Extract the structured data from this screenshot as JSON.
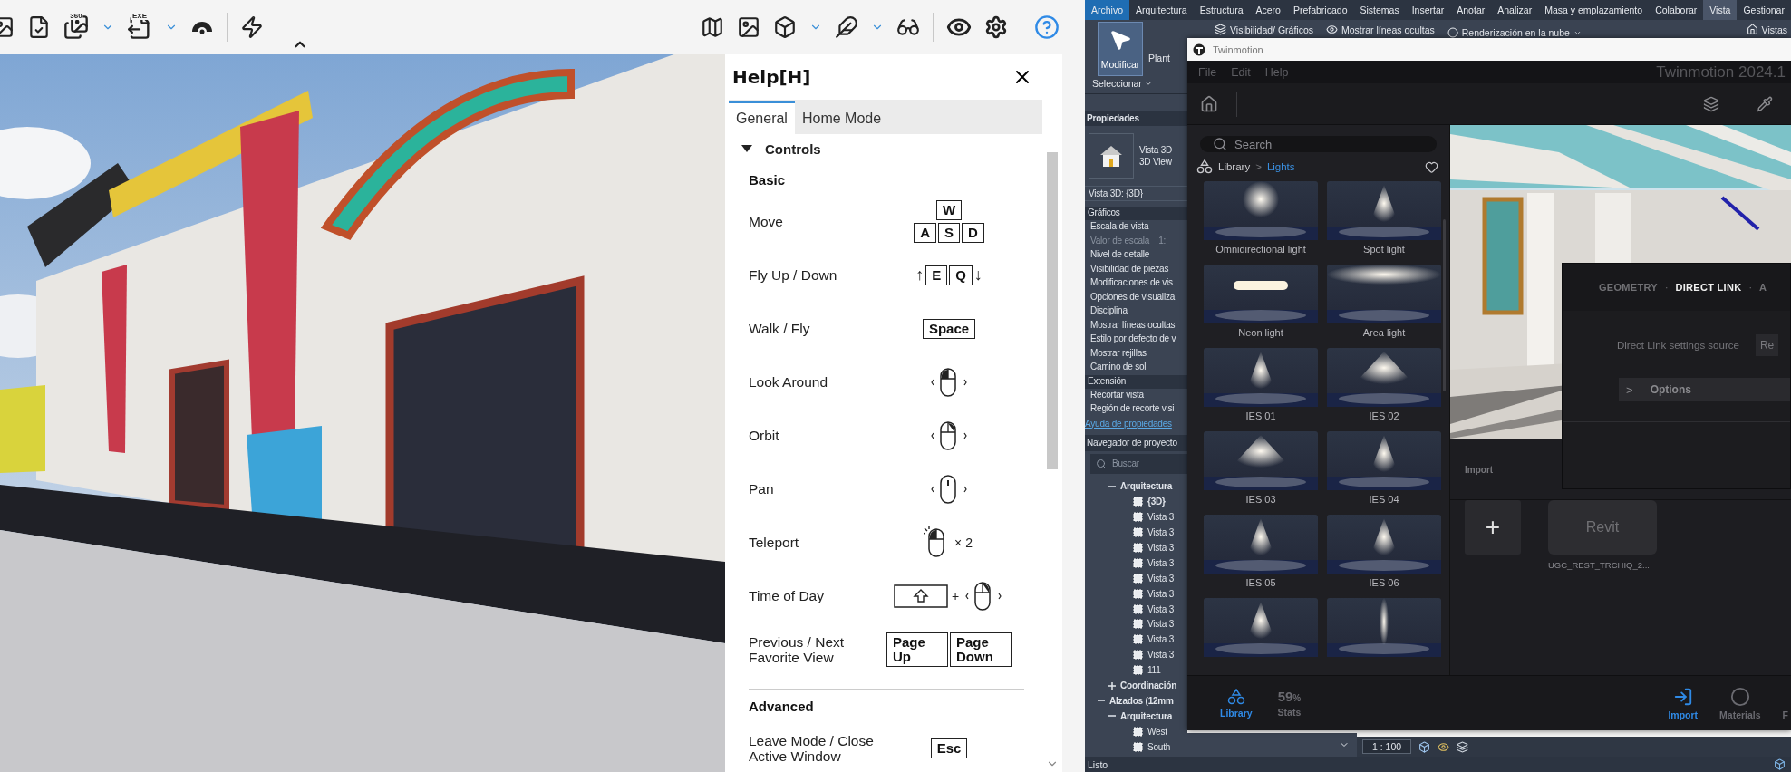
{
  "viewer": {
    "toolbar": {
      "panorama_badge": "360",
      "export_badge": "EXE"
    },
    "help": {
      "title": "Help[H]",
      "tabs": [
        {
          "label": "General",
          "selected": true
        },
        {
          "label": "Home Mode",
          "selected": false
        }
      ],
      "section": {
        "label": "Controls",
        "expanded": true,
        "groups": [
          {
            "title": "Basic",
            "rows": [
              {
                "label": "Move",
                "kind": "keypad",
                "keys": [
                  [
                    "W"
                  ],
                  [
                    "A",
                    "S",
                    "D"
                  ]
                ]
              },
              {
                "label": "Fly Up / Down",
                "kind": "inline",
                "controls": [
                  {
                    "kind": "arrow",
                    "text": "↑"
                  },
                  {
                    "kind": "key",
                    "text": "E"
                  },
                  {
                    "kind": "key",
                    "text": "Q"
                  },
                  {
                    "kind": "arrow",
                    "text": "↓"
                  }
                ]
              },
              {
                "label": "Walk / Fly",
                "kind": "inline",
                "controls": [
                  {
                    "kind": "key",
                    "text": "Space"
                  }
                ]
              },
              {
                "label": "Look Around",
                "kind": "inline",
                "controls": [
                  {
                    "kind": "mouse-left"
                  }
                ]
              },
              {
                "label": "Orbit",
                "kind": "inline",
                "controls": [
                  {
                    "kind": "mouse-right"
                  }
                ]
              },
              {
                "label": "Pan",
                "kind": "inline",
                "controls": [
                  {
                    "kind": "mouse-middle"
                  }
                ]
              },
              {
                "label": "Teleport",
                "kind": "inline",
                "controls": [
                  {
                    "kind": "double-click"
                  },
                  {
                    "kind": "text",
                    "text": "× 2"
                  }
                ]
              },
              {
                "label": "Time of Day",
                "kind": "inline",
                "controls": [
                  {
                    "kind": "shift"
                  },
                  {
                    "kind": "text",
                    "text": "+"
                  },
                  {
                    "kind": "mouse-right"
                  }
                ]
              },
              {
                "label": "Previous / Next Favorite View",
                "kind": "inline",
                "controls": [
                  {
                    "kind": "key",
                    "text": "Page Up"
                  },
                  {
                    "kind": "key",
                    "text": "Page Down"
                  }
                ]
              }
            ]
          },
          {
            "title": "Advanced",
            "rows": [
              {
                "label": "Leave Mode / Close Active Window",
                "kind": "inline",
                "controls": [
                  {
                    "kind": "key",
                    "text": "Esc"
                  }
                ]
              }
            ]
          }
        ]
      }
    }
  },
  "revit": {
    "menu_tabs": [
      {
        "label": "Archivo",
        "kind": "application",
        "selected": false
      },
      {
        "label": "Arquitectura",
        "kind": "tab",
        "selected": false
      },
      {
        "label": "Estructura",
        "kind": "tab",
        "selected": false
      },
      {
        "label": "Acero",
        "kind": "tab",
        "selected": false
      },
      {
        "label": "Prefabricado",
        "kind": "tab",
        "selected": false
      },
      {
        "label": "Sistemas",
        "kind": "tab",
        "selected": false
      },
      {
        "label": "Insertar",
        "kind": "tab",
        "selected": false
      },
      {
        "label": "Anotar",
        "kind": "tab",
        "selected": false
      },
      {
        "label": "Analizar",
        "kind": "tab",
        "selected": false
      },
      {
        "label": "Masa y emplazamiento",
        "kind": "tab",
        "selected": false
      },
      {
        "label": "Colaborar",
        "kind": "tab",
        "selected": false
      },
      {
        "label": "Vista",
        "kind": "tab",
        "selected": true
      },
      {
        "label": "Gestionar",
        "kind": "tab",
        "selected": false
      }
    ],
    "ribbon": {
      "modify_button": "Modificar",
      "select_menu": "Seleccionar",
      "plan_button": "Plant",
      "visibility_button": "Visibilidad/ Gráficos",
      "hidden_lines_button": "Mostrar líneas ocultas",
      "cloud_render_button": "Renderización en la nube",
      "views_button": "Vistas"
    },
    "properties": {
      "title": "Propiedades",
      "type_name": "Vista 3D",
      "type_subname": "3D View",
      "instance": "Vista 3D: {3D}",
      "sections": [
        {
          "label": "Gráficos",
          "rows": [
            {
              "label": "Escala de vista",
              "disabled": false
            },
            {
              "label": "Valor de escala",
              "value": "1:",
              "disabled": true
            },
            {
              "label": "Nivel de detalle",
              "disabled": false
            },
            {
              "label": "Visibilidad de piezas",
              "disabled": false
            },
            {
              "label": "Modificaciones de vis",
              "disabled": false
            },
            {
              "label": "Opciones de visualiza",
              "disabled": false
            },
            {
              "label": "Disciplina",
              "disabled": false
            },
            {
              "label": "Mostrar líneas ocultas",
              "disabled": false
            },
            {
              "label": "Estilo por defecto de v",
              "disabled": false
            },
            {
              "label": "Mostrar rejillas",
              "disabled": false
            },
            {
              "label": "Camino de sol",
              "disabled": false
            }
          ]
        },
        {
          "label": "Extensión",
          "rows": [
            {
              "label": "Recortar vista",
              "disabled": false
            },
            {
              "label": "Región de recorte visi",
              "disabled": false
            }
          ]
        }
      ],
      "help_link": "Ayuda de propiedades"
    },
    "project_browser": {
      "title": "Navegador de proyecto",
      "search_placeholder": "Buscar",
      "tree": [
        {
          "children": [
            {
              "label": "Arquitectura",
              "expanded": true,
              "selected": false,
              "children": [
                {
                  "label": "{3D}",
                  "selected": true
                },
                {
                  "label": "Vista 3",
                  "selected": false
                },
                {
                  "label": "Vista 3",
                  "selected": false
                },
                {
                  "label": "Vista 3",
                  "selected": false
                },
                {
                  "label": "Vista 3",
                  "selected": false
                },
                {
                  "label": "Vista 3",
                  "selected": false
                },
                {
                  "label": "Vista 3",
                  "selected": false
                },
                {
                  "label": "Vista 3",
                  "selected": false
                },
                {
                  "label": "Vista 3",
                  "selected": false
                },
                {
                  "label": "Vista 3",
                  "selected": false
                },
                {
                  "label": "Vista 3",
                  "selected": false
                },
                {
                  "label": "111",
                  "selected": false
                }
              ]
            },
            {
              "label": "Coordinación",
              "expanded": false,
              "selected": false
            }
          ]
        },
        {
          "label": "Alzados (12mm",
          "expanded": true,
          "selected": false,
          "children": [
            {
              "label": "Arquitectura",
              "expanded": true,
              "selected": false,
              "children": [
                {
                  "label": "West",
                  "selected": false
                },
                {
                  "label": "South",
                  "selected": false
                }
              ]
            }
          ]
        }
      ]
    },
    "view_scale": "1 : 100",
    "status": "Listo"
  },
  "twinmotion": {
    "title": "Twinmotion",
    "menus": [
      "File",
      "Edit",
      "Help"
    ],
    "product_title": "Twinmotion 2024.1",
    "library": {
      "search_placeholder": "Search",
      "breadcrumb": [
        {
          "label": "Library",
          "selected": false
        },
        {
          "label": "Lights",
          "selected": true
        }
      ],
      "breadcrumb_separator": ">",
      "items": [
        {
          "label": "Omnidirectional light",
          "kind": "picture"
        },
        {
          "label": "Spot light",
          "kind": "picture"
        },
        {
          "label": "Neon light",
          "kind": "picture"
        },
        {
          "label": "Area light",
          "kind": "picture"
        },
        {
          "label": "IES 01",
          "kind": "picture"
        },
        {
          "label": "IES 02",
          "kind": "picture"
        },
        {
          "label": "IES 03",
          "kind": "picture"
        },
        {
          "label": "IES 04",
          "kind": "picture"
        },
        {
          "label": "IES 05",
          "kind": "picture"
        },
        {
          "label": "IES 06",
          "kind": "picture"
        },
        {
          "kind": "picture"
        },
        {
          "kind": "picture"
        }
      ]
    },
    "import": {
      "title": "Import",
      "add_button": "+",
      "files": [
        {
          "type": "Revit",
          "name": "UGC_REST_TRCHIQ_2..."
        }
      ]
    },
    "dialog": {
      "tabs": [
        {
          "label": "GEOMETRY",
          "selected": false
        },
        {
          "label": "DIRECT LINK",
          "selected": true
        },
        {
          "label": "A",
          "selected": false
        }
      ],
      "separators": [
        "·",
        "·"
      ],
      "settings_label": "Direct Link settings source",
      "settings_value": "Re",
      "options": {
        "marker": ">",
        "label": "Options",
        "expanded": false
      }
    },
    "panel_tabs": [
      {
        "label": "Library",
        "kind": "library",
        "selected": true
      },
      {
        "label": "Stats",
        "kind": "stats",
        "value": "59",
        "unit": "%",
        "selected": false
      }
    ],
    "mode_tabs": [
      {
        "label": "Import",
        "kind": "import",
        "selected": true
      },
      {
        "label": "Materials",
        "kind": "materials",
        "selected": false
      },
      {
        "label": "F",
        "kind": "unknown",
        "selected": false
      }
    ]
  }
}
